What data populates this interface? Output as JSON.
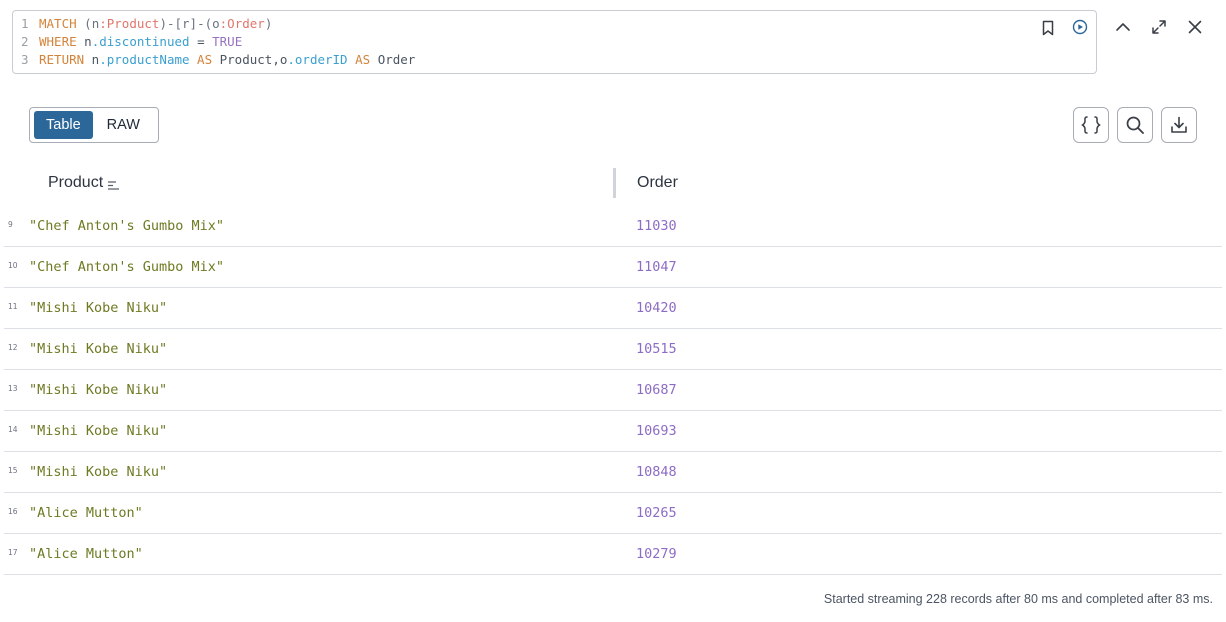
{
  "editor": {
    "lines": [
      {
        "num": "1",
        "tokens": [
          {
            "t": "MATCH",
            "c": "kw"
          },
          {
            "t": " (n",
            "c": "punct"
          },
          {
            "t": ":Product",
            "c": "label"
          },
          {
            "t": ")-[r]-(o",
            "c": "punct"
          },
          {
            "t": ":Order",
            "c": "label"
          },
          {
            "t": ")",
            "c": "punct"
          }
        ]
      },
      {
        "num": "2",
        "tokens": [
          {
            "t": "WHERE",
            "c": "kw"
          },
          {
            "t": " n",
            "c": "plain"
          },
          {
            "t": ".discontinued",
            "c": "prop"
          },
          {
            "t": " = ",
            "c": "plain"
          },
          {
            "t": "TRUE",
            "c": "bool"
          }
        ]
      },
      {
        "num": "3",
        "tokens": [
          {
            "t": "RETURN",
            "c": "kw"
          },
          {
            "t": " n",
            "c": "plain"
          },
          {
            "t": ".productName",
            "c": "prop"
          },
          {
            "t": " AS",
            "c": "kw"
          },
          {
            "t": " Product,o",
            "c": "plain"
          },
          {
            "t": ".orderID",
            "c": "prop"
          },
          {
            "t": " AS",
            "c": "kw"
          },
          {
            "t": " Order",
            "c": "plain"
          }
        ]
      }
    ]
  },
  "toolbar": {
    "table_label": "Table",
    "raw_label": "RAW"
  },
  "table": {
    "columns": [
      "Product",
      "Order"
    ],
    "rows": [
      {
        "idx": "9",
        "product": "\"Chef Anton's Gumbo Mix\"",
        "order": "11030"
      },
      {
        "idx": "10",
        "product": "\"Chef Anton's Gumbo Mix\"",
        "order": "11047"
      },
      {
        "idx": "11",
        "product": "\"Mishi Kobe Niku\"",
        "order": "10420"
      },
      {
        "idx": "12",
        "product": "\"Mishi Kobe Niku\"",
        "order": "10515"
      },
      {
        "idx": "13",
        "product": "\"Mishi Kobe Niku\"",
        "order": "10687"
      },
      {
        "idx": "14",
        "product": "\"Mishi Kobe Niku\"",
        "order": "10693"
      },
      {
        "idx": "15",
        "product": "\"Mishi Kobe Niku\"",
        "order": "10848"
      },
      {
        "idx": "16",
        "product": "\"Alice Mutton\"",
        "order": "10265"
      },
      {
        "idx": "17",
        "product": "\"Alice Mutton\"",
        "order": "10279"
      }
    ]
  },
  "status": {
    "text": "Started streaming 228 records after 80 ms and completed after 83 ms."
  },
  "icons": {
    "editor": [
      "bookmark-icon",
      "run-icon"
    ],
    "window": [
      "collapse-icon",
      "fullscreen-icon",
      "close-icon"
    ],
    "tools": [
      "json-icon",
      "search-icon",
      "download-icon"
    ]
  },
  "colors": {
    "accent": "#2c6799",
    "string_value": "#6e7a22",
    "number_value": "#8d6cc6",
    "keyword": "#d4843a",
    "label": "#e0766b",
    "property": "#3b9fcf",
    "boolean": "#9872c0"
  }
}
